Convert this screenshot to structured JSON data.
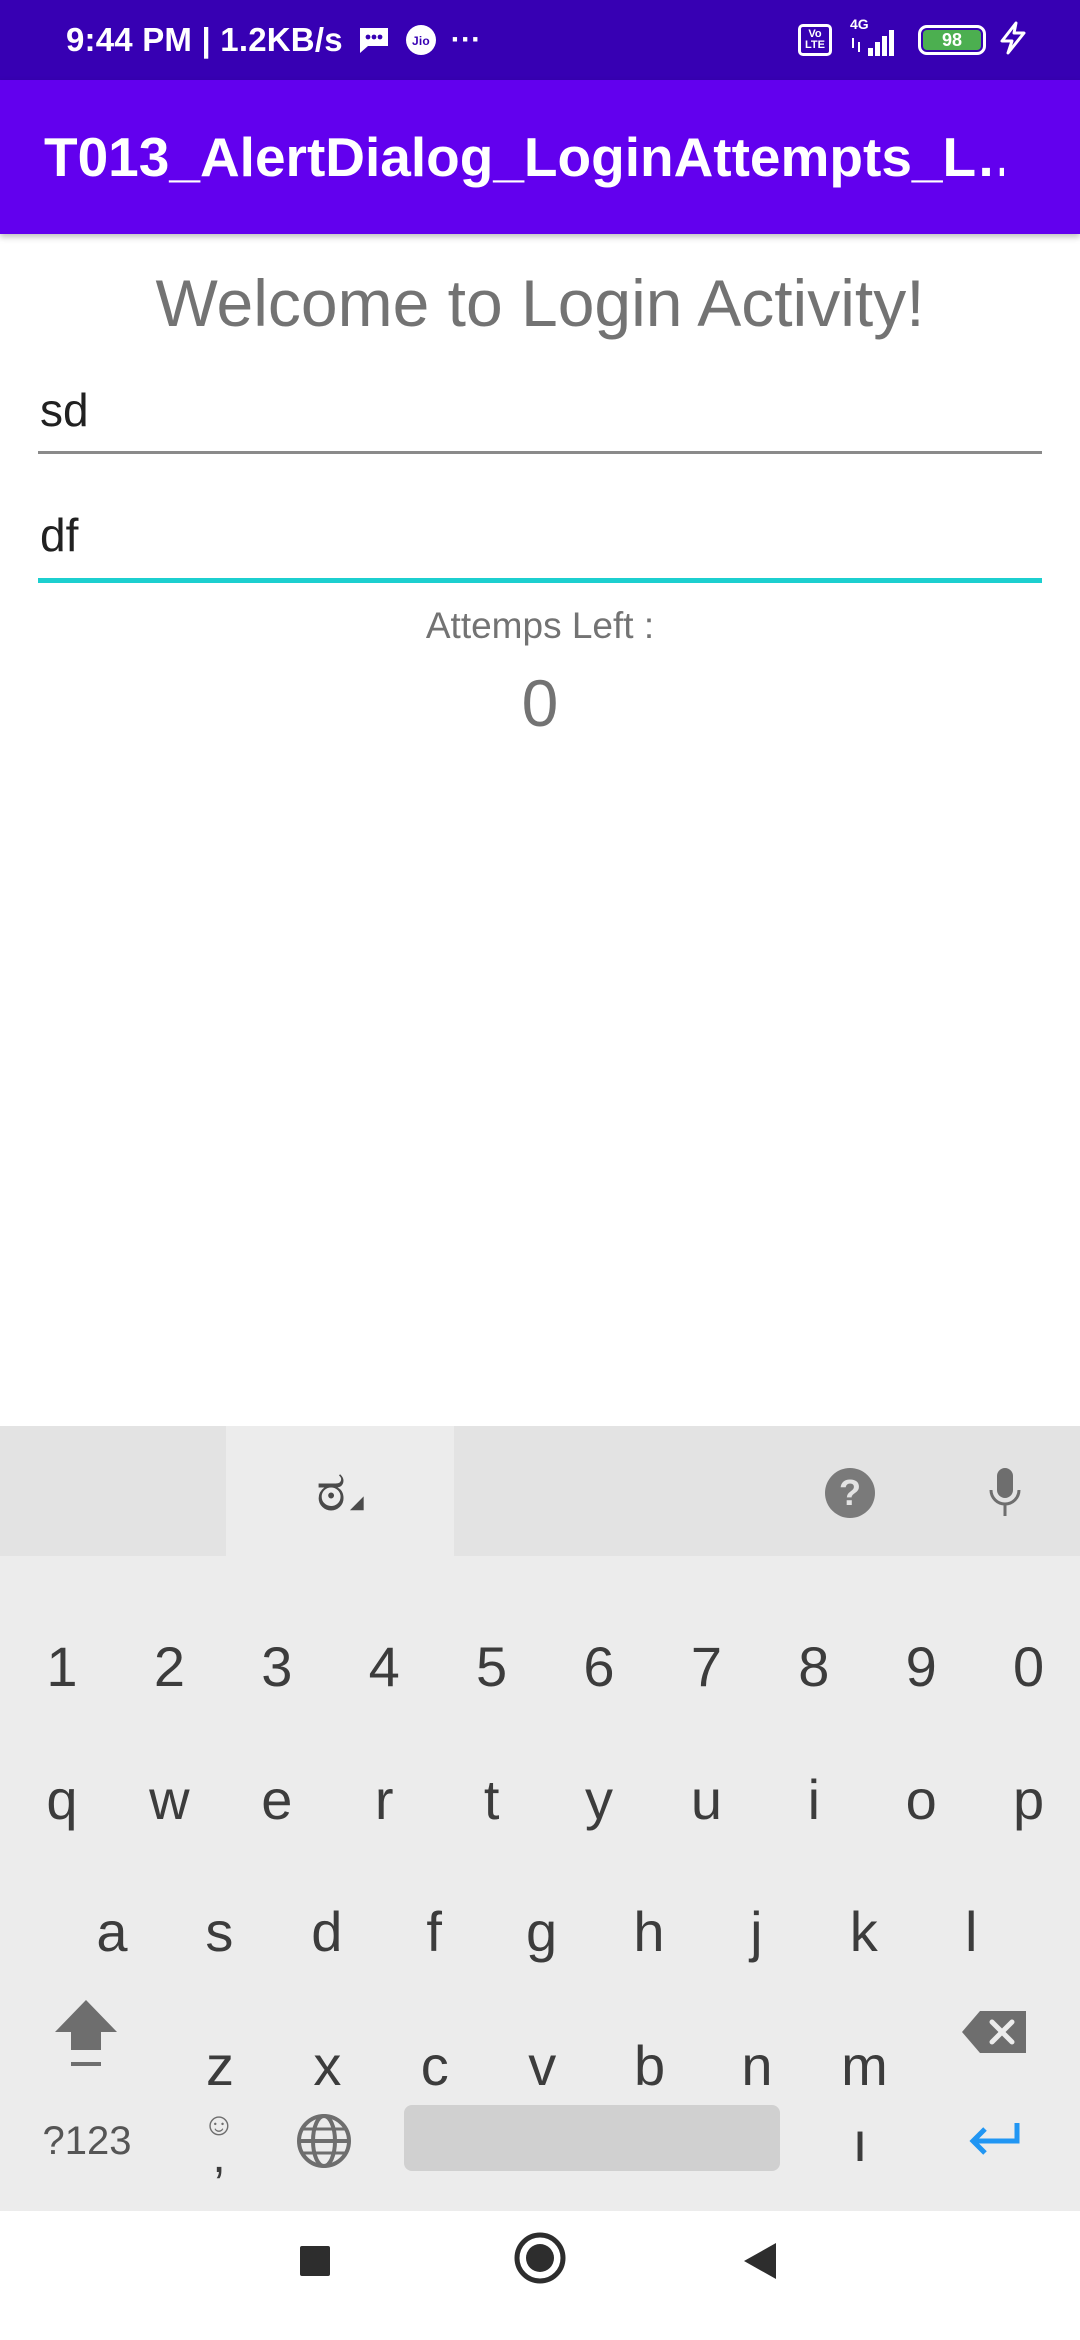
{
  "status_bar": {
    "time_speed": "9:44 PM | 1.2KB/s",
    "jio": "Jio",
    "more": "···",
    "volte_top": "Vo",
    "volte_bottom": "LTE",
    "network": "4G",
    "battery": "98"
  },
  "app_bar": {
    "title": "T013_AlertDialog_LoginAttempts_L…"
  },
  "login": {
    "welcome": "Welcome to Login Activity!",
    "username_value": "sd",
    "password_value": "df",
    "attempts_label": "Attemps Left :",
    "attempts_value": "0"
  },
  "keyboard": {
    "language_glyph": "ಠ",
    "help": "?",
    "row_numbers": [
      "1",
      "2",
      "3",
      "4",
      "5",
      "6",
      "7",
      "8",
      "9",
      "0"
    ],
    "row1": [
      "q",
      "w",
      "e",
      "r",
      "t",
      "y",
      "u",
      "i",
      "o",
      "p"
    ],
    "row2": [
      "a",
      "s",
      "d",
      "f",
      "g",
      "h",
      "j",
      "k",
      "l"
    ],
    "row3": [
      "z",
      "x",
      "c",
      "v",
      "b",
      "n",
      "m"
    ],
    "symbols_key": "?123",
    "comma_key": ",",
    "emoji_glyph": "☺",
    "period_key": "ı"
  }
}
